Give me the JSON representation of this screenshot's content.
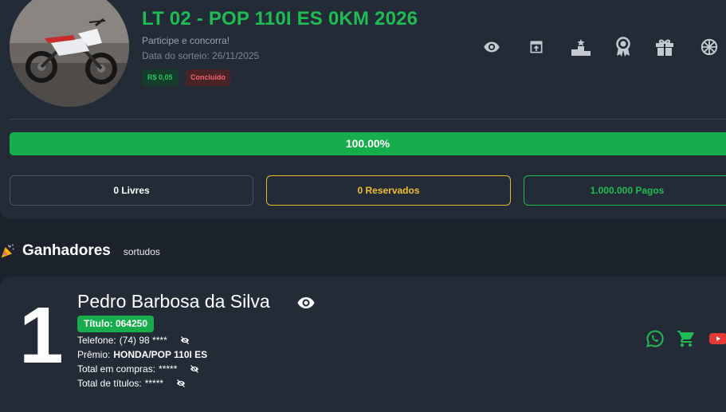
{
  "raffle": {
    "title": "LT 02 - POP 110I ES 0KM 2026",
    "subtitle": "Participe e concorra!",
    "draw_date": "Data do sorteio: 26/11/2025",
    "price_badge": "R$ 0,05",
    "status_badge": "Concluído",
    "progress_percent": 100,
    "progress_text": "100.00%",
    "stats": {
      "free": "0 Livres",
      "reserved": "0 Reservados",
      "paid": "1.000.000 Pagos"
    }
  },
  "actions": [
    "eye-icon",
    "share-icon",
    "podium-icon",
    "award-icon",
    "gift-icon",
    "wheel-icon"
  ],
  "winners": {
    "title": "Ganhadores",
    "subtitle": "sortudos",
    "items": [
      {
        "rank": "1",
        "name": "Pedro Barbosa da Silva",
        "ticket": "Título: 064250",
        "phone_label": "Telefone:",
        "phone_value": "(74) 98 ****",
        "prize_label": "Prêmio:",
        "prize_value": "HONDA/POP 110I ES",
        "total_spent_label": "Total em compras:",
        "total_spent_value": "*****",
        "total_tickets_label": "Total de títulos:",
        "total_tickets_value": "*****"
      }
    ]
  },
  "colors": {
    "accent_green": "#1fbb54",
    "reserved_yellow": "#f0bf2f",
    "status_red": "#f0646c",
    "youtube_red": "#e53935"
  }
}
